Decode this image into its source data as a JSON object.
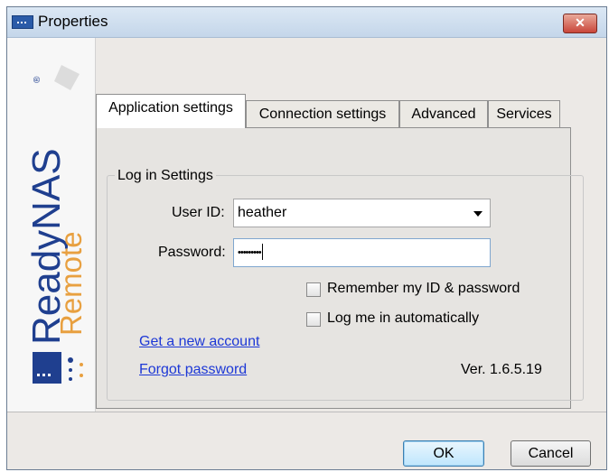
{
  "window": {
    "title": "Properties",
    "close_label": "✕"
  },
  "brand": {
    "name": "ReadyNAS",
    "product": "Remote",
    "registered": "®"
  },
  "tabs": [
    {
      "label": "Application settings",
      "active": true
    },
    {
      "label": "Connection settings",
      "active": false
    },
    {
      "label": "Advanced",
      "active": false
    },
    {
      "label": "Services",
      "active": false
    }
  ],
  "login": {
    "group_title": "Log in Settings",
    "user_id_label": "User ID:",
    "user_id_value": "heather",
    "password_label": "Password:",
    "password_value": "•••••••••",
    "remember_label": "Remember my ID & password",
    "remember_checked": false,
    "auto_login_label": "Log me in automatically",
    "auto_login_checked": false,
    "new_account_link": "Get a new account",
    "forgot_password_link": "Forgot password",
    "version": "Ver. 1.6.5.19"
  },
  "buttons": {
    "ok": "OK",
    "cancel": "Cancel"
  },
  "colors": {
    "link": "#1d38d6",
    "brand_blue": "#1f3f8f",
    "brand_orange": "#e8a040"
  }
}
